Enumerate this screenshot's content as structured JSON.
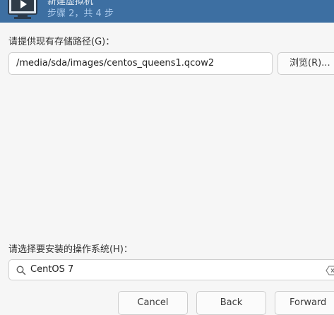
{
  "header": {
    "title": "新建虚拟机",
    "step": "步骤 2，共 4 步"
  },
  "storage": {
    "label": "请提供现有存储路径(G)：",
    "path_value": "/media/sda/images/centos_queens1.qcow2",
    "browse_label": "浏览(R)..."
  },
  "os": {
    "label": "请选择要安装的操作系统(H)：",
    "search_value": "CentOS 7"
  },
  "footer": {
    "cancel_label": "Cancel",
    "back_label": "Back",
    "forward_label": "Forward"
  },
  "icons": {
    "header": "monitor-play-icon",
    "search": "search-icon",
    "clear": "clear-text-icon"
  }
}
